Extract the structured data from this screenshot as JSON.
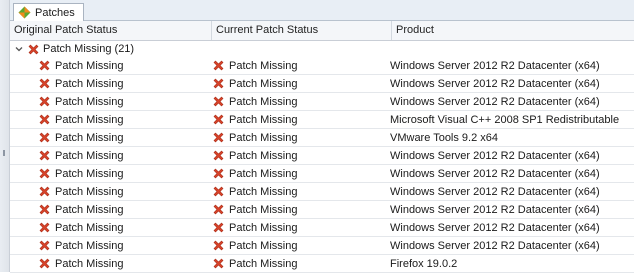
{
  "tab": {
    "label": "Patches"
  },
  "columns": [
    "Original Patch Status",
    "Current Patch Status",
    "Product"
  ],
  "group": {
    "label": "Patch Missing (21)"
  },
  "rows": [
    {
      "original": "Patch Missing",
      "current": "Patch Missing",
      "product": "Windows Server 2012 R2 Datacenter (x64)"
    },
    {
      "original": "Patch Missing",
      "current": "Patch Missing",
      "product": "Windows Server 2012 R2 Datacenter (x64)"
    },
    {
      "original": "Patch Missing",
      "current": "Patch Missing",
      "product": "Windows Server 2012 R2 Datacenter (x64)"
    },
    {
      "original": "Patch Missing",
      "current": "Patch Missing",
      "product": "Microsoft Visual C++ 2008 SP1 Redistributable"
    },
    {
      "original": "Patch Missing",
      "current": "Patch Missing",
      "product": "VMware Tools 9.2 x64"
    },
    {
      "original": "Patch Missing",
      "current": "Patch Missing",
      "product": "Windows Server 2012 R2 Datacenter (x64)"
    },
    {
      "original": "Patch Missing",
      "current": "Patch Missing",
      "product": "Windows Server 2012 R2 Datacenter (x64)"
    },
    {
      "original": "Patch Missing",
      "current": "Patch Missing",
      "product": "Windows Server 2012 R2 Datacenter (x64)"
    },
    {
      "original": "Patch Missing",
      "current": "Patch Missing",
      "product": "Windows Server 2012 R2 Datacenter (x64)"
    },
    {
      "original": "Patch Missing",
      "current": "Patch Missing",
      "product": "Windows Server 2012 R2 Datacenter (x64)"
    },
    {
      "original": "Patch Missing",
      "current": "Patch Missing",
      "product": "Windows Server 2012 R2 Datacenter (x64)"
    },
    {
      "original": "Patch Missing",
      "current": "Patch Missing",
      "product": "Firefox 19.0.2"
    }
  ],
  "icons": {
    "tab": "patches-icon",
    "status": "patch-missing-x-icon",
    "expander": "chevron-down-icon"
  },
  "colors": {
    "missing": "#d9442b",
    "tab_icon_green": "#5aa832",
    "tab_icon_orange": "#f08a1c"
  }
}
